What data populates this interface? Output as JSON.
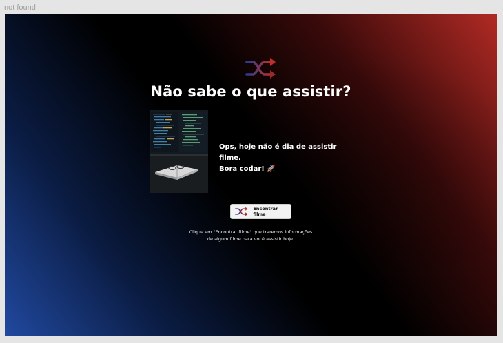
{
  "frame": {
    "label": "not found"
  },
  "header": {
    "logo_icon": "shuffle-icon",
    "title": "Não sabe o que assistir?"
  },
  "movie": {
    "poster_icon": "code-laptop-image",
    "description_line1": "Ops, hoje não é dia de assistir filme.",
    "description_line2": "Bora codar! 🚀"
  },
  "action": {
    "button_icon": "shuffle-icon",
    "button_label": "Encontrar filme"
  },
  "hint": {
    "line1": "Clique em \"Encontrar filme\" que traremos informações",
    "line2": "de algum filme para você assistir hoje."
  },
  "colors": {
    "gradient_blue": "#2149a0",
    "gradient_black": "#000000",
    "gradient_red": "#b12a24",
    "button_bg": "#f3f3f3",
    "title_text": "#ffffff"
  }
}
